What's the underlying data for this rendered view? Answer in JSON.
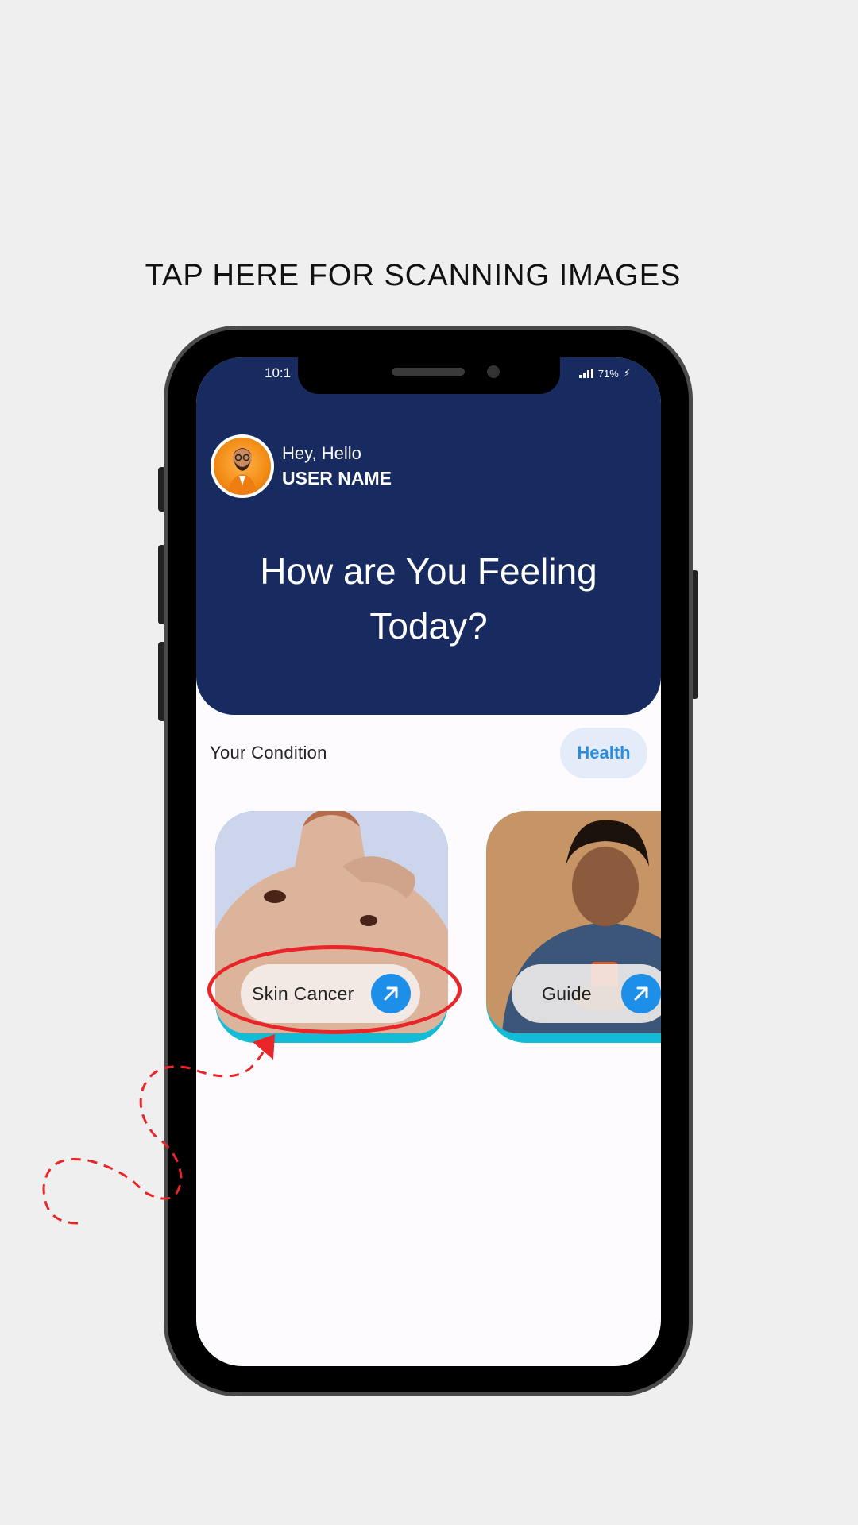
{
  "caption": "TAP HERE FOR SCANNING IMAGES",
  "status": {
    "time": "10:1",
    "battery": "71%"
  },
  "header": {
    "greeting": "Hey, Hello",
    "user_name": "USER NAME",
    "headline_line1": "How are You Feeling",
    "headline_line2": "Today?"
  },
  "conditions": {
    "label": "Your Condition",
    "chip": "Health",
    "cards": [
      {
        "label": "Skin Cancer",
        "icon": "arrow-up-right-icon"
      },
      {
        "label": "Guide",
        "icon": "arrow-up-right-icon"
      }
    ]
  },
  "colors": {
    "header": "#172b60",
    "accent": "#1e8fe8",
    "card_base": "#13bcd6",
    "highlight": "#e8262a"
  }
}
